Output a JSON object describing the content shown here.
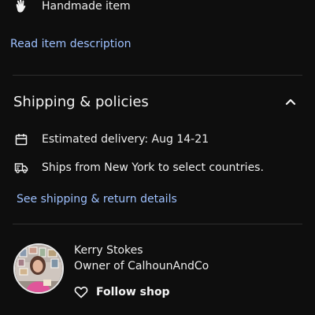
{
  "details": {
    "handmade_label": "Handmade item",
    "read_description_label": "Read item description"
  },
  "shipping": {
    "title": "Shipping & policies",
    "estimated_delivery": "Estimated delivery: Aug 14-21",
    "ships_from": "Ships from New York to select countries.",
    "see_details_label": "See shipping & return details"
  },
  "seller": {
    "name": "Kerry Stokes",
    "role": "Owner of CalhounAndCo",
    "follow_label": "Follow shop"
  },
  "colors": {
    "background": "#0e0e0e",
    "link": "#9ec1ff",
    "text": "#ececec",
    "divider": "#2d2d2d"
  }
}
